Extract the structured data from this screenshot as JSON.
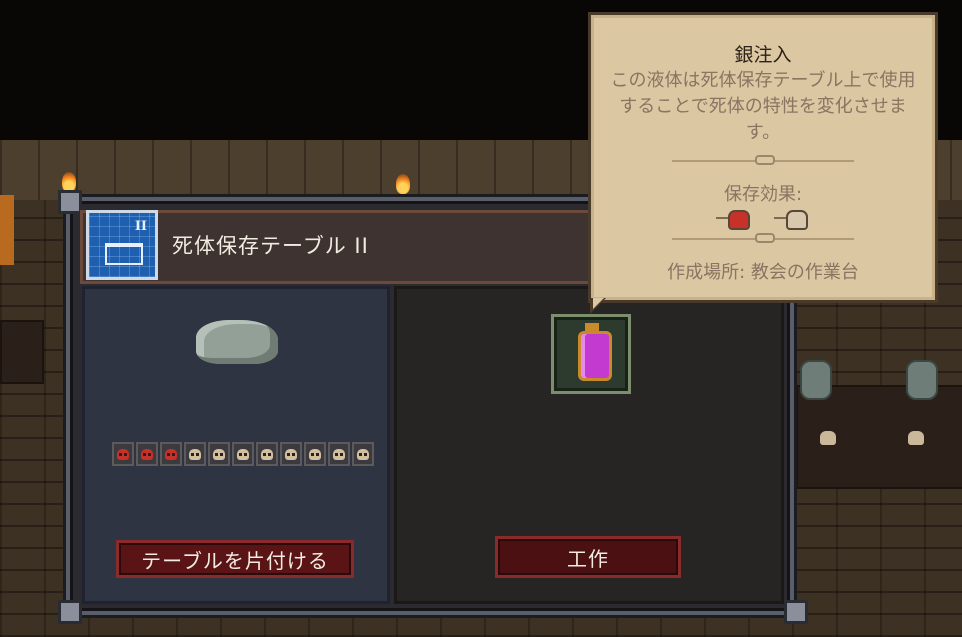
{
  "workstation": {
    "title": "死体保存テーブル II",
    "icon": "blueprint-icon",
    "blueprint_numeral": "II"
  },
  "corpse_preservation": {
    "filled": 3,
    "total": 11,
    "filled_color": "#c8302a",
    "empty_color": "#d2bfa0"
  },
  "buttons": {
    "clear_table_label": "テーブルを片付ける",
    "craft_label": "工作"
  },
  "selected_item": {
    "icon": "silver-injection-vial-icon",
    "color": "#c23ad0"
  },
  "tooltip": {
    "title": "銀注入",
    "description": "この液体は死体保存テーブル上で使用することで死体の特性を変化させます。",
    "effect_label": "保存効果:",
    "effects": [
      {
        "icon": "red-skull-icon",
        "kind": "add",
        "color": "#c8302a"
      },
      {
        "icon": "white-skull-icon",
        "kind": "remove",
        "color": "#d8c8ae"
      }
    ],
    "crafted_at": "作成場所:  教会の作業台"
  }
}
